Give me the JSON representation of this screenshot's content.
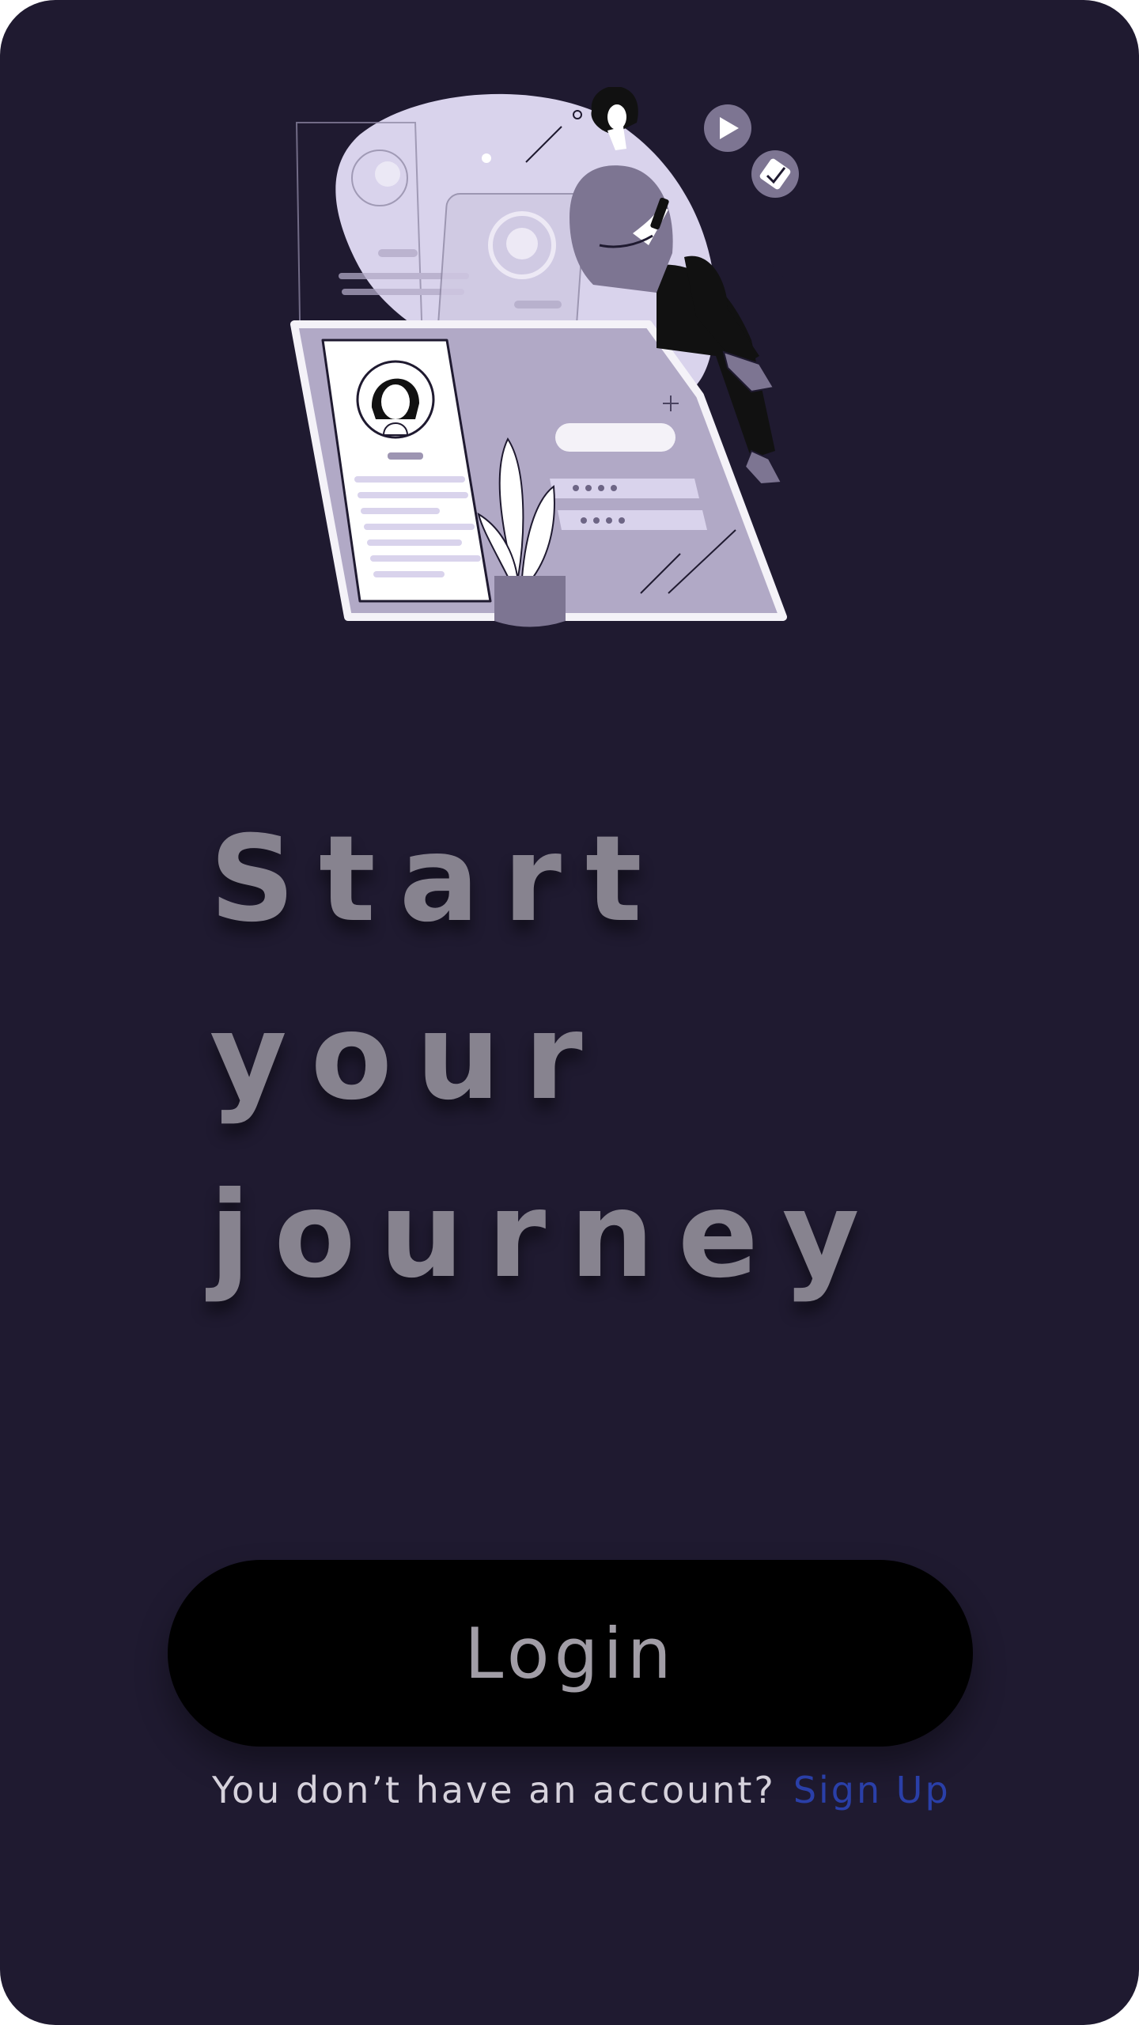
{
  "onboarding": {
    "headline_lines": [
      "Start",
      "your",
      "journey"
    ],
    "login_label": "Login",
    "signup_prompt": "You don’t have an account?",
    "signup_link": "Sign Up"
  },
  "colors": {
    "background": "#1f1a30",
    "headline": "#87838f",
    "button_bg": "#000000",
    "button_text": "#a19da6",
    "link": "#2a3fa8",
    "illustration_light": "#d9d3ec",
    "illustration_mid": "#b1a9c6",
    "illustration_dark": "#7d7592"
  },
  "icons": {
    "play": "play-icon",
    "check": "check-icon"
  }
}
